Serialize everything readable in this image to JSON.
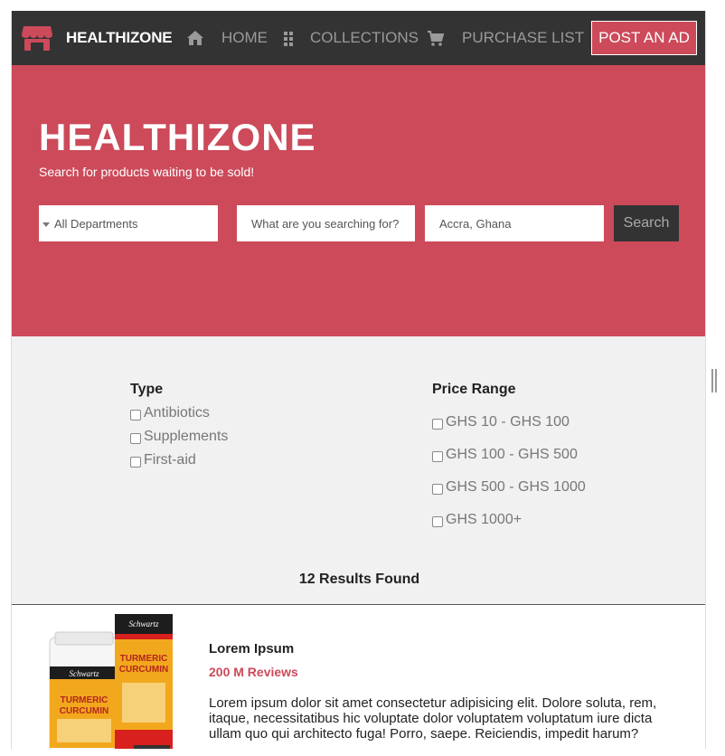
{
  "nav": {
    "brand": "HEALTHIZONE",
    "items": [
      {
        "label": "HOME",
        "icon": "home-icon"
      },
      {
        "label": "COLLECTIONS",
        "icon": "grid-icon"
      },
      {
        "label": "PURCHASE LIST",
        "icon": "cart-icon"
      }
    ],
    "post_ad": "POST AN AD"
  },
  "hero": {
    "title": "HEALTHIZONE",
    "subtitle": "Search for products waiting to be sold!",
    "department": "All Departments",
    "search_placeholder": "What are you searching for?",
    "location": "Accra, Ghana",
    "search_button": "Search"
  },
  "filters": {
    "type_title": "Type",
    "types": [
      "Antibiotics",
      "Supplements",
      "First-aid"
    ],
    "price_title": "Price Range",
    "prices": [
      "GHS 10 - GHS 100",
      "GHS 100 - GHS 500",
      "GHS 500 - GHS 1000",
      "GHS 1000+"
    ],
    "results": "12 Results Found"
  },
  "product": {
    "name": "Lorem Ipsum",
    "reviews": "200 M Reviews",
    "description": "Lorem ipsum dolor sit amet consectetur adipisicing elit. Dolore soluta, rem, itaque, necessitatibus hic voluptate dolor voluptatem voluptatum iure dicta ullam quo qui architecto fuga! Porro, saepe. Reiciendis, impedit harum?",
    "image_brand": "Schwartz",
    "image_text": "TURMERIC CURCUMIN"
  },
  "colors": {
    "accent": "#cc4a5a",
    "nav_bg": "#333333",
    "filters_bg": "#f1f1f1"
  }
}
